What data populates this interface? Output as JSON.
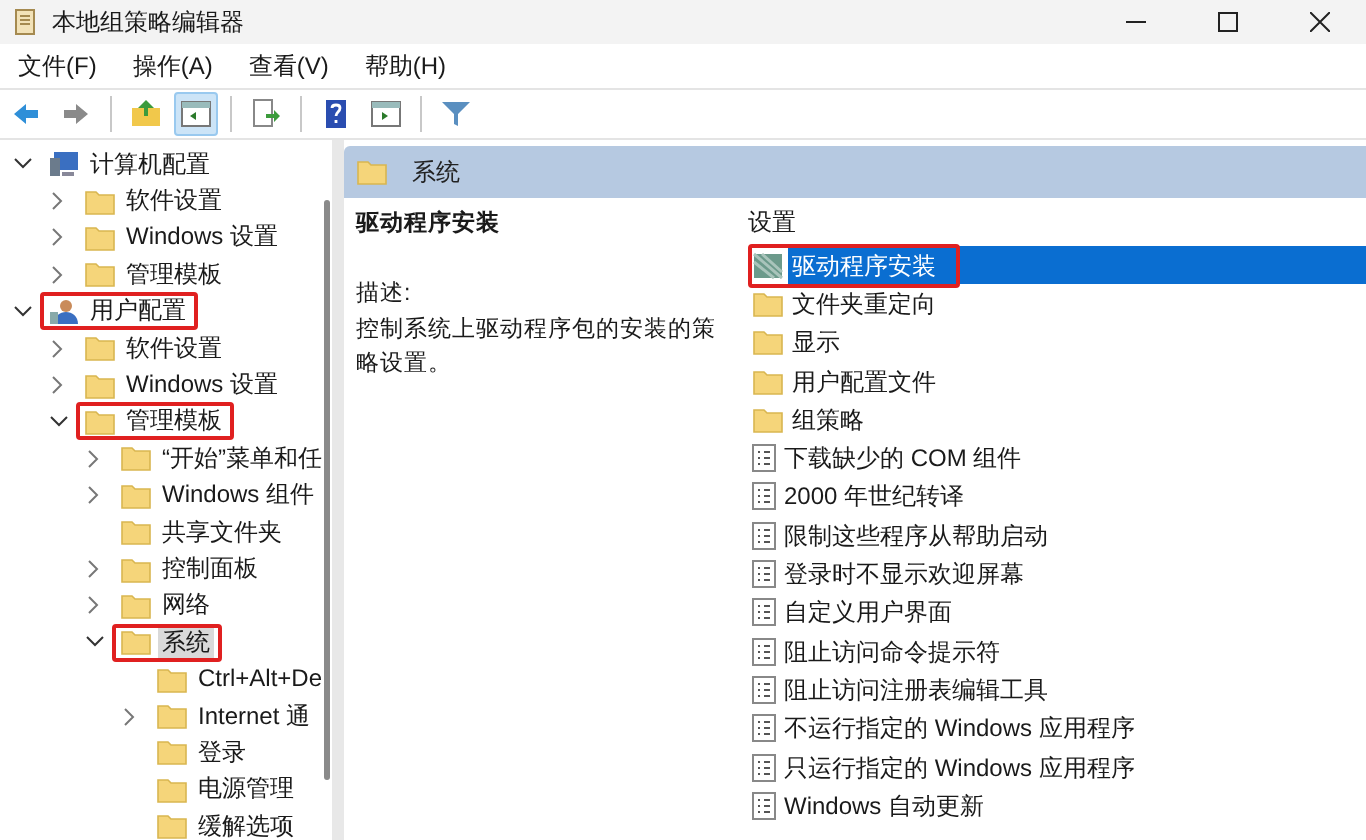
{
  "window": {
    "title": "本地组策略编辑器"
  },
  "menu": [
    "文件(F)",
    "操作(A)",
    "查看(V)",
    "帮助(H)"
  ],
  "toolbar": [
    {
      "kind": "back"
    },
    {
      "kind": "forward"
    },
    {
      "kind": "sep"
    },
    {
      "kind": "up"
    },
    {
      "kind": "tree",
      "pressed": true
    },
    {
      "kind": "sep"
    },
    {
      "kind": "export"
    },
    {
      "kind": "sep"
    },
    {
      "kind": "help"
    },
    {
      "kind": "pane"
    },
    {
      "kind": "sep"
    },
    {
      "kind": "filter"
    }
  ],
  "tree": [
    {
      "label": "计算机配置",
      "kind": "computer",
      "expanded": true,
      "selected": false,
      "children": [
        {
          "label": "软件设置",
          "kind": "folder",
          "expanded": false,
          "selected": false
        },
        {
          "label": "Windows 设置",
          "kind": "folder",
          "expanded": false,
          "selected": false
        },
        {
          "label": "管理模板",
          "kind": "folder",
          "expanded": false,
          "selected": false
        }
      ]
    },
    {
      "label": "用户配置",
      "kind": "user",
      "expanded": true,
      "highlighted": true,
      "selected": false,
      "children": [
        {
          "label": "软件设置",
          "kind": "folder",
          "expanded": false,
          "selected": false
        },
        {
          "label": "Windows 设置",
          "kind": "folder",
          "expanded": false,
          "selected": false
        },
        {
          "label": "管理模板",
          "kind": "folder",
          "expanded": true,
          "highlighted": true,
          "selected": false,
          "children": [
            {
              "label": "“开始”菜单和任",
              "kind": "folder",
              "expanded": false,
              "selected": false
            },
            {
              "label": "Windows 组件",
              "kind": "folder",
              "expanded": false,
              "selected": false
            },
            {
              "label": "共享文件夹",
              "kind": "folder",
              "selected": false
            },
            {
              "label": "控制面板",
              "kind": "folder",
              "expanded": false,
              "selected": false
            },
            {
              "label": "网络",
              "kind": "folder",
              "expanded": false,
              "selected": false
            },
            {
              "label": "系统",
              "kind": "folder",
              "expanded": true,
              "highlighted": true,
              "selected": true,
              "children": [
                {
                  "label": "Ctrl+Alt+De",
                  "kind": "folder",
                  "selected": false
                },
                {
                  "label": "Internet 通",
                  "kind": "folder",
                  "expanded": false,
                  "selected": false
                },
                {
                  "label": "登录",
                  "kind": "folder",
                  "selected": false
                },
                {
                  "label": "电源管理",
                  "kind": "folder",
                  "selected": false
                },
                {
                  "label": "缓解选项",
                  "kind": "folder",
                  "selected": false
                }
              ]
            }
          ]
        }
      ]
    }
  ],
  "pane_header": {
    "title": "系统"
  },
  "detail": {
    "title": "驱动程序安装",
    "description_label": "描述:",
    "description": "控制系统上驱动程序包的安装的策略设置。"
  },
  "list": {
    "column": "设置",
    "items": [
      {
        "label": "驱动程序安装",
        "kind": "setting-folder",
        "selected": true,
        "highlighted": true
      },
      {
        "label": "文件夹重定向",
        "kind": "folder",
        "selected": false
      },
      {
        "label": "显示",
        "kind": "folder",
        "selected": false
      },
      {
        "label": "用户配置文件",
        "kind": "folder",
        "selected": false
      },
      {
        "label": "组策略",
        "kind": "folder",
        "selected": false
      },
      {
        "label": "下载缺少的 COM 组件",
        "kind": "policy",
        "selected": false
      },
      {
        "label": "2000 年世纪转译",
        "kind": "policy",
        "selected": false
      },
      {
        "label": "限制这些程序从帮助启动",
        "kind": "policy",
        "selected": false
      },
      {
        "label": "登录时不显示欢迎屏幕",
        "kind": "policy",
        "selected": false
      },
      {
        "label": "自定义用户界面",
        "kind": "policy",
        "selected": false
      },
      {
        "label": "阻止访问命令提示符",
        "kind": "policy",
        "selected": false
      },
      {
        "label": "阻止访问注册表编辑工具",
        "kind": "policy",
        "selected": false
      },
      {
        "label": "不运行指定的 Windows 应用程序",
        "kind": "policy",
        "selected": false
      },
      {
        "label": "只运行指定的 Windows 应用程序",
        "kind": "policy",
        "selected": false
      },
      {
        "label": "Windows 自动更新",
        "kind": "policy",
        "selected": false
      }
    ]
  }
}
